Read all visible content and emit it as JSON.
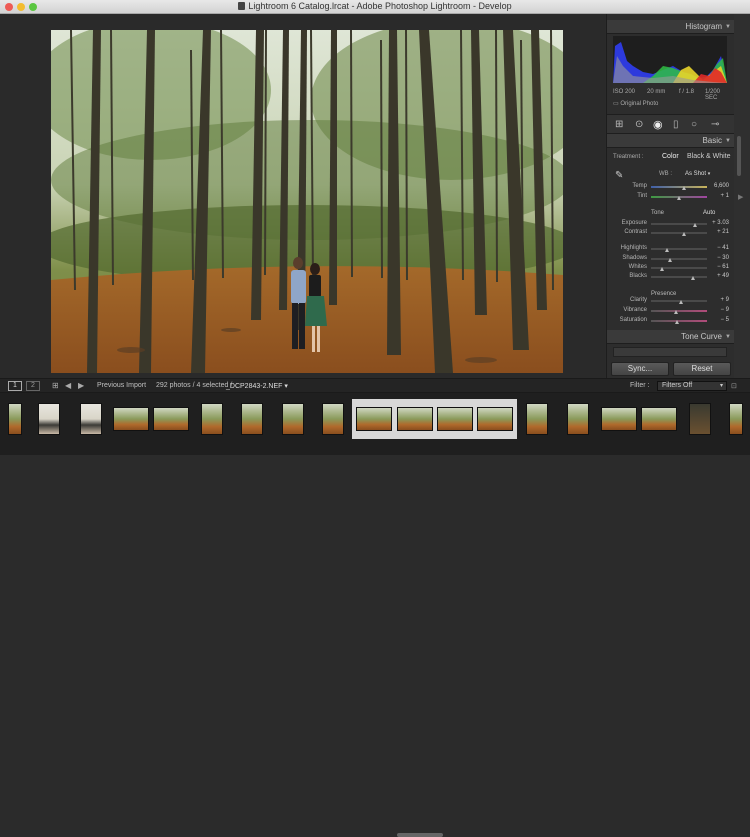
{
  "window": {
    "title": "Lightroom 6 Catalog.lrcat - Adobe Photoshop Lightroom - Develop"
  },
  "panels": {
    "histogram": {
      "header": "Histogram",
      "iso": "ISO 200",
      "focal": "20 mm",
      "aperture": "f / 1.8",
      "shutter": "1/200 SEC",
      "original_photo_label": "Original Photo"
    },
    "basic": {
      "header": "Basic",
      "treatment_label": "Treatment :",
      "color_label": "Color",
      "bw_label": "Black & White",
      "wb_label": "WB :",
      "wb_value": "As Shot",
      "tone_label": "Tone",
      "auto_label": "Auto",
      "presence_label": "Presence",
      "sliders": [
        {
          "label": "Temp",
          "value": "6,600",
          "pos": 0.6
        },
        {
          "label": "Tint",
          "value": "+ 1",
          "pos": 0.5
        },
        {
          "label": "Exposure",
          "value": "+ 3.03",
          "pos": 0.8
        },
        {
          "label": "Contrast",
          "value": "+ 21",
          "pos": 0.6
        },
        {
          "label": "Highlights",
          "value": "− 41",
          "pos": 0.3
        },
        {
          "label": "Shadows",
          "value": "− 30",
          "pos": 0.35
        },
        {
          "label": "Whites",
          "value": "− 61",
          "pos": 0.2
        },
        {
          "label": "Blacks",
          "value": "+ 49",
          "pos": 0.75
        },
        {
          "label": "Clarity",
          "value": "+ 9",
          "pos": 0.55
        },
        {
          "label": "Vibrance",
          "value": "− 9",
          "pos": 0.45
        },
        {
          "label": "Saturation",
          "value": "− 5",
          "pos": 0.47
        }
      ]
    },
    "tone_curve": {
      "header": "Tone Curve"
    },
    "buttons": {
      "sync": "Sync...",
      "reset": "Reset"
    }
  },
  "filmstrip_bar": {
    "page1": "1",
    "page2": "2",
    "source": "Previous Import",
    "count": "292 photos / 4 selected /",
    "filename": "_DCP2843-2.NEF",
    "filter_label": "Filter :",
    "filter_value": "Filters Off"
  },
  "colors": {
    "panel_bg": "#2d2d2d",
    "header_bg": "#3a3a3a",
    "accent_text": "#c8c8c8"
  }
}
